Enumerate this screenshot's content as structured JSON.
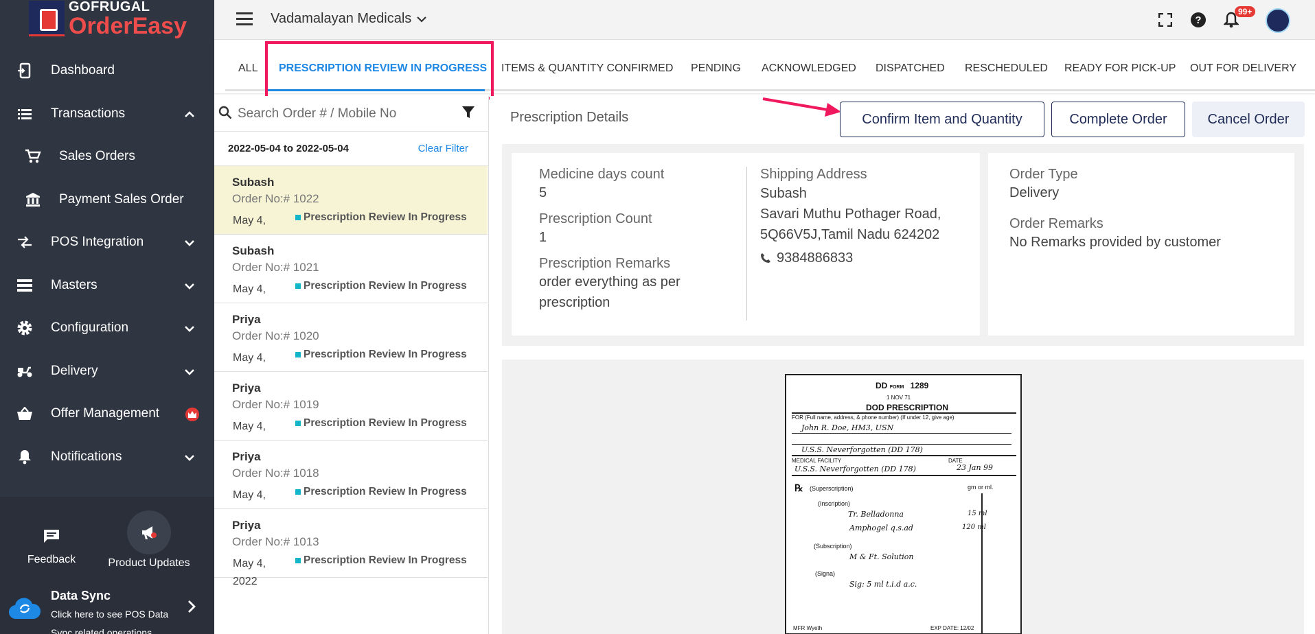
{
  "brand": {
    "top": "GOFRUGAL",
    "main": "OrderEasy"
  },
  "sidebar": {
    "items": [
      {
        "label": "Dashboard",
        "icon": "dashboard-icon"
      },
      {
        "label": "Transactions",
        "icon": "list-icon",
        "expanded": true
      },
      {
        "label": "Sales Orders",
        "icon": "cart-icon"
      },
      {
        "label": "Payment Sales Order",
        "icon": "bank-icon"
      },
      {
        "label": "POS Integration",
        "icon": "sync-arrows-icon"
      },
      {
        "label": "Masters",
        "icon": "stack-icon"
      },
      {
        "label": "Configuration",
        "icon": "gear-icon"
      },
      {
        "label": "Delivery",
        "icon": "scooter-icon"
      },
      {
        "label": "Offer Management",
        "icon": "basket-icon",
        "badge_icon": "crown-icon"
      },
      {
        "label": "Notifications",
        "icon": "bell-icon"
      }
    ],
    "feedback_label": "Feedback",
    "updates_label": "Product Updates",
    "datasync": {
      "title": "Data Sync",
      "desc": "Click here to see POS Data Sync related operations"
    }
  },
  "topbar": {
    "store_name": "Vadamalayan Medicals",
    "notif_badge": "99+"
  },
  "tabs": [
    "ALL",
    "PRESCRIPTION REVIEW IN PROGRESS",
    "ITEMS & QUANTITY CONFIRMED",
    "PENDING",
    "ACKNOWLEDGED",
    "DISPATCHED",
    "RESCHEDULED",
    "READY FOR PICK-UP",
    "OUT FOR DELIVERY"
  ],
  "active_tab": "PRESCRIPTION REVIEW IN PROGRESS",
  "search": {
    "placeholder": "Search Order # / Mobile No"
  },
  "filter": {
    "range": "2022-05-04 to 2022-05-04",
    "clear_label": "Clear Filter"
  },
  "orders": [
    {
      "name": "Subash",
      "order_no": "Order No:# 1022",
      "date": "May 4,",
      "status": "Prescription Review In Progress",
      "selected": true
    },
    {
      "name": "Subash",
      "order_no": "Order No:# 1021",
      "date": "May 4,",
      "status": "Prescription Review In Progress"
    },
    {
      "name": "Priya",
      "order_no": "Order No:# 1020",
      "date": "May 4,",
      "status": "Prescription Review In Progress"
    },
    {
      "name": "Priya",
      "order_no": "Order No:# 1019",
      "date": "May 4,",
      "status": "Prescription Review In Progress"
    },
    {
      "name": "Priya",
      "order_no": "Order No:# 1018",
      "date": "May 4,",
      "status": "Prescription Review In Progress"
    },
    {
      "name": "Priya",
      "order_no": "Order No:# 1013",
      "date": "May 4,",
      "date2": "2022",
      "status": "Prescription Review In Progress"
    }
  ],
  "details": {
    "title": "Prescription Details",
    "buttons": {
      "confirm": "Confirm Item and Quantity",
      "complete": "Complete Order",
      "cancel": "Cancel Order"
    },
    "medicine_days_label": "Medicine days count",
    "medicine_days_value": "5",
    "rx_count_label": "Prescription Count",
    "rx_count_value": "1",
    "rx_remarks_label": "Prescription Remarks",
    "rx_remarks_value": "order everything as per prescription",
    "shipping_label": "Shipping Address",
    "shipping_name": "Subash",
    "shipping_address": "Savari Muthu Pothager Road, 5Q66V5J,Tamil Nadu 624202",
    "phone": "9384886833",
    "order_type_label": "Order Type",
    "order_type_value": "Delivery",
    "order_remarks_label": "Order Remarks",
    "order_remarks_value": "No Remarks provided by customer"
  },
  "prescription_image": {
    "form": "DD",
    "form_small": "FORM",
    "form_no": "1289",
    "date_line": "1 NOV 71",
    "heading": "DOD PRESCRIPTION",
    "for_label": "FOR  (Full name, address, & phone number) (If under 12, give age)",
    "patient": "John R. Doe, HM3, USN",
    "ship": "U.S.S. Neverforgotten   (DD 178)",
    "facility_label": "MEDICAL FACILITY",
    "facility": "U.S.S. Neverforgotten  (DD 178)",
    "date_label": "DATE",
    "date": "23 Jan 99",
    "rx_symbol": "℞",
    "superscription": "(Superscription)",
    "units": "gm or ml.",
    "inscription": "(Inscription)",
    "drug1": "Tr. Belladonna",
    "qty1": "15  ml",
    "drug2": "Amphogel  q.s.ad",
    "qty2": "120  ml",
    "subscription": "(Subscription)",
    "sub_text": "M & Ft. Solution",
    "signa": "(Signa)",
    "signa_text": "Sig:  5 ml  t.i.d  a.c.",
    "mfr_label": "MFR",
    "mfr": "Wyeth",
    "exp_label": "EXP DATE:",
    "exp": "12/02"
  },
  "colors": {
    "accent": "#1e88e5",
    "highlight": "#f0195e",
    "status_dot": "#13b6c9",
    "sidebar": "#2f3541",
    "selected_row": "#f7f4d5"
  }
}
